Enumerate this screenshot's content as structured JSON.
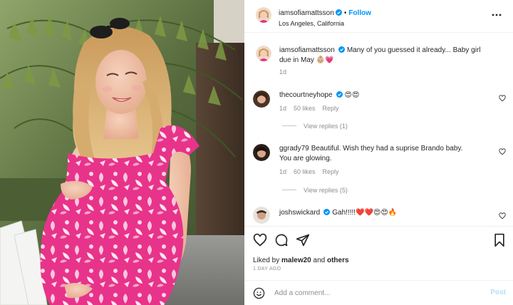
{
  "header": {
    "username": "iamsofiamattsson",
    "separator": "•",
    "follow_label": "Follow",
    "location": "Los Angeles, California"
  },
  "caption": {
    "username": "iamsofiamattsson",
    "text": "Many of you guessed it already... Baby girl due in May 👶🏼💗",
    "age": "1d"
  },
  "comments": [
    {
      "username": "thecourtneyhope",
      "verified": true,
      "text": "😍😍",
      "age": "1d",
      "likes": "50 likes",
      "reply_label": "Reply",
      "view_replies": "View replies (1)"
    },
    {
      "username": "ggrady79",
      "verified": false,
      "text": "Beautiful. Wish they had a suprise Brando baby.",
      "text2": "You are glowing.",
      "age": "1d",
      "likes": "60 likes",
      "reply_label": "Reply",
      "view_replies": "View replies (5)"
    },
    {
      "username": "joshswickard",
      "verified": true,
      "text": "Gah!!!!!❤️❤️😍😍🔥"
    }
  ],
  "actions": {
    "icons": [
      "heart-icon",
      "comment-icon",
      "share-icon",
      "bookmark-icon"
    ],
    "liked_prefix": "Liked by",
    "liked_user": "malew20",
    "liked_and": "and",
    "liked_others": "others",
    "timestamp": "1 DAY AGO"
  },
  "add_comment": {
    "placeholder": "Add a comment...",
    "post_label": "Post"
  },
  "colors": {
    "accent": "#0095f6",
    "post_disabled": "#b2dffc",
    "secondary_text": "#8e8e8e",
    "dress_pink": "#e8338a"
  }
}
